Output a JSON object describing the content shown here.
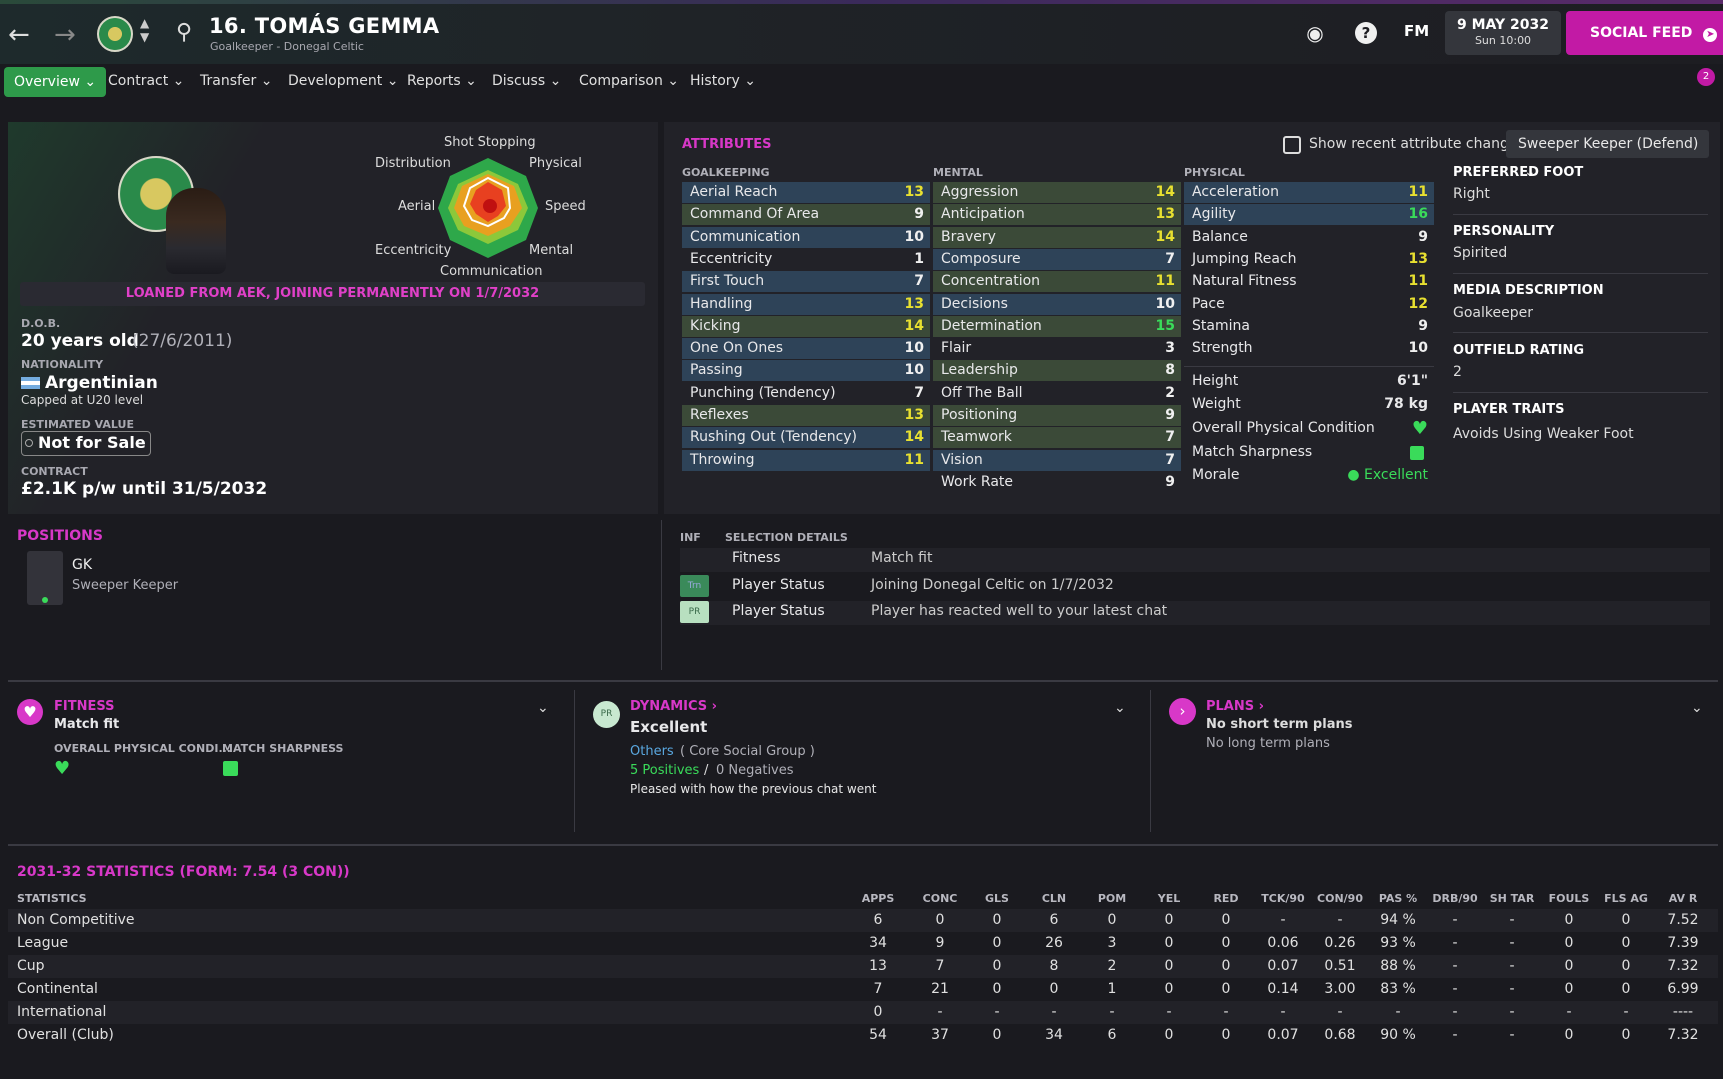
{
  "header": {
    "title": "16. TOMÁS GEMMA",
    "subtitle": "Goalkeeper - Donegal Celtic",
    "fm": "FM",
    "date": "9 MAY 2032",
    "time": "Sun 10:00",
    "social": "SOCIAL FEED",
    "notifications": "2"
  },
  "menu": [
    "Overview",
    "Contract",
    "Transfer",
    "Development",
    "Reports",
    "Discuss",
    "Comparison",
    "History"
  ],
  "radar": {
    "labels": {
      "top": "Shot Stopping",
      "tl": "Distribution",
      "tr": "Physical",
      "l": "Aerial",
      "r": "Speed",
      "bl": "Eccentricity",
      "br": "Mental",
      "b": "Communication"
    }
  },
  "profile": {
    "loan": "LOANED FROM AEK, JOINING PERMANENTLY ON 1/7/2032",
    "dob_label": "D.O.B.",
    "dob": "20 years old",
    "dob_date": "(27/6/2011)",
    "nat_label": "NATIONALITY",
    "nat": "Argentinian",
    "nat_note": "Capped at U20 level",
    "ev_label": "ESTIMATED VALUE",
    "ev": "Not for Sale",
    "contract_label": "CONTRACT",
    "contract": "£2.1K p/w until 31/5/2032"
  },
  "attributes": {
    "title": "ATTRIBUTES",
    "show_changes": "Show recent attribute changes",
    "role": "Sweeper Keeper (Defend)",
    "gk_title": "GOALKEEPING",
    "mental_title": "MENTAL",
    "physical_title": "PHYSICAL",
    "gk": [
      {
        "n": "Aerial Reach",
        "v": "13",
        "c": "blue"
      },
      {
        "n": "Command Of Area",
        "v": "9",
        "c": "green"
      },
      {
        "n": "Communication",
        "v": "10",
        "c": "blue"
      },
      {
        "n": "Eccentricity",
        "v": "1",
        "c": "dk"
      },
      {
        "n": "First Touch",
        "v": "7",
        "c": "blue"
      },
      {
        "n": "Handling",
        "v": "13",
        "c": "blue"
      },
      {
        "n": "Kicking",
        "v": "14",
        "c": "green"
      },
      {
        "n": "One On Ones",
        "v": "10",
        "c": "blue"
      },
      {
        "n": "Passing",
        "v": "10",
        "c": "blue"
      },
      {
        "n": "Punching (Tendency)",
        "v": "7",
        "c": "dk"
      },
      {
        "n": "Reflexes",
        "v": "13",
        "c": "green"
      },
      {
        "n": "Rushing Out (Tendency)",
        "v": "14",
        "c": "blue"
      },
      {
        "n": "Throwing",
        "v": "11",
        "c": "blue"
      }
    ],
    "mental": [
      {
        "n": "Aggression",
        "v": "14",
        "c": "green"
      },
      {
        "n": "Anticipation",
        "v": "13",
        "c": "green"
      },
      {
        "n": "Bravery",
        "v": "14",
        "c": "green"
      },
      {
        "n": "Composure",
        "v": "7",
        "c": "blue"
      },
      {
        "n": "Concentration",
        "v": "11",
        "c": "green"
      },
      {
        "n": "Decisions",
        "v": "10",
        "c": "blue"
      },
      {
        "n": "Determination",
        "v": "15",
        "c": "green"
      },
      {
        "n": "Flair",
        "v": "3",
        "c": "dk"
      },
      {
        "n": "Leadership",
        "v": "8",
        "c": "green"
      },
      {
        "n": "Off The Ball",
        "v": "2",
        "c": "dk"
      },
      {
        "n": "Positioning",
        "v": "9",
        "c": "green"
      },
      {
        "n": "Teamwork",
        "v": "7",
        "c": "green"
      },
      {
        "n": "Vision",
        "v": "7",
        "c": "blue"
      },
      {
        "n": "Work Rate",
        "v": "9",
        "c": "dk"
      }
    ],
    "physical": [
      {
        "n": "Acceleration",
        "v": "11",
        "c": "blue"
      },
      {
        "n": "Agility",
        "v": "16",
        "c": "blue"
      },
      {
        "n": "Balance",
        "v": "9",
        "c": "dk"
      },
      {
        "n": "Jumping Reach",
        "v": "13",
        "c": "dk"
      },
      {
        "n": "Natural Fitness",
        "v": "11",
        "c": "dk"
      },
      {
        "n": "Pace",
        "v": "12",
        "c": "dk"
      },
      {
        "n": "Stamina",
        "v": "9",
        "c": "dk"
      },
      {
        "n": "Strength",
        "v": "10",
        "c": "dk"
      }
    ],
    "extra": [
      {
        "n": "Height",
        "v": "6'1\""
      },
      {
        "n": "Weight",
        "v": "78 kg"
      },
      {
        "n": "Overall Physical Condition",
        "v": ""
      },
      {
        "n": "Match Sharpness",
        "v": ""
      },
      {
        "n": "Morale",
        "v": "Excellent"
      }
    ]
  },
  "right": {
    "foot_h": "PREFERRED FOOT",
    "foot": "Right",
    "pers_h": "PERSONALITY",
    "pers": "Spirited",
    "media_h": "MEDIA DESCRIPTION",
    "media": "Goalkeeper",
    "out_h": "OUTFIELD RATING",
    "out": "2",
    "traits_h": "PLAYER TRAITS",
    "traits": "Avoids Using Weaker Foot"
  },
  "positions": {
    "title": "POSITIONS",
    "pos": "GK",
    "role": "Sweeper Keeper"
  },
  "selection": {
    "inf": "INF",
    "title": "SELECTION DETAILS",
    "rows": [
      {
        "badge": "",
        "k": "Fitness",
        "v": "Match fit"
      },
      {
        "badge": "Trn",
        "k": "Player Status",
        "v": "Joining Donegal Celtic on 1/7/2032"
      },
      {
        "badge": "PR",
        "k": "Player Status",
        "v": "Player has reacted well to your latest chat"
      }
    ]
  },
  "fitness": {
    "title": "FITNESS",
    "status": "Match fit",
    "opc": "OVERALL PHYSICAL CONDI...",
    "ms": "MATCH SHARPNESS"
  },
  "dynamics": {
    "title": "DYNAMICS",
    "badge": "PR",
    "status": "Excellent",
    "group": "Others",
    "group_note": "( Core Social Group )",
    "pos": "5 Positives",
    "sep": "/",
    "neg": "0 Negatives",
    "note": "Pleased with how the previous chat went"
  },
  "plans": {
    "title": "PLANS",
    "a": "No short term plans",
    "b": "No long term plans"
  },
  "stats": {
    "title": "2031-32 STATISTICS (FORM: 7.54 (3 CON))",
    "cols": [
      "STATISTICS",
      "APPS",
      "CONC",
      "GLS",
      "CLN",
      "POM",
      "YEL",
      "RED",
      "TCK/90",
      "CON/90",
      "PAS %",
      "DRB/90",
      "SH TAR",
      "FOULS",
      "FLS AG",
      "AV R"
    ],
    "rows": [
      [
        "Non Competitive",
        "6",
        "0",
        "0",
        "6",
        "0",
        "0",
        "0",
        "-",
        "-",
        "94 %",
        "-",
        "-",
        "0",
        "0",
        "7.52"
      ],
      [
        "League",
        "34",
        "9",
        "0",
        "26",
        "3",
        "0",
        "0",
        "0.06",
        "0.26",
        "93 %",
        "-",
        "-",
        "0",
        "0",
        "7.39"
      ],
      [
        "Cup",
        "13",
        "7",
        "0",
        "8",
        "2",
        "0",
        "0",
        "0.07",
        "0.51",
        "88 %",
        "-",
        "-",
        "0",
        "0",
        "7.32"
      ],
      [
        "Continental",
        "7",
        "21",
        "0",
        "0",
        "1",
        "0",
        "0",
        "0.14",
        "3.00",
        "83 %",
        "-",
        "-",
        "0",
        "0",
        "6.99"
      ],
      [
        "International",
        "0",
        "-",
        "-",
        "-",
        "-",
        "-",
        "-",
        "-",
        "-",
        "-",
        "-",
        "-",
        "-",
        "-",
        "----"
      ],
      [
        "Overall (Club)",
        "54",
        "37",
        "0",
        "34",
        "6",
        "0",
        "0",
        "0.07",
        "0.68",
        "90 %",
        "-",
        "-",
        "0",
        "0",
        "7.32"
      ]
    ]
  }
}
